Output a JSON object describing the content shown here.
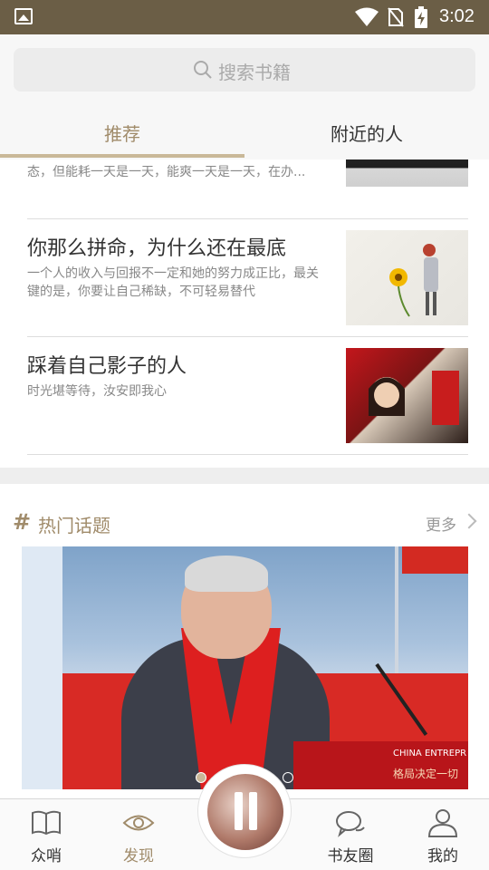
{
  "status_bar": {
    "time": "3:02"
  },
  "header": {
    "search_placeholder": "搜索书籍",
    "tabs": [
      {
        "label": "推荐",
        "active": true
      },
      {
        "label": "附近的人",
        "active": false
      }
    ]
  },
  "articles": [
    {
      "title": "",
      "summary": "态，但能耗一天是一天，能爽一天是一天，在办..."
    },
    {
      "title": "你那么拼命，为什么还在最底",
      "summary": "一个人的收入与回报不一定和她的努力成正比，最关键的是，你要让自己稀缺，不可轻易替代"
    },
    {
      "title": "踩着自己影子的人",
      "summary": "时光堪等待，汝安即我心"
    }
  ],
  "topics": {
    "title": "热门话题",
    "more_label": "更多",
    "banner": {
      "podium_text_en": "CHINA ENTREPR",
      "podium_text_cn": "格局决定一切",
      "current_slide": 1,
      "slide_count": 2
    }
  },
  "bottom_nav": {
    "items": [
      {
        "label": "众哨",
        "icon": "book-icon",
        "active": false
      },
      {
        "label": "发现",
        "icon": "eye-icon",
        "active": true
      },
      {
        "label": "书友圈",
        "icon": "chat-bubbles-icon",
        "active": false
      },
      {
        "label": "我的",
        "icon": "user-icon",
        "active": false
      }
    ],
    "center_button_icon": "pause-icon"
  },
  "colors": {
    "status_bar": "#6b5e46",
    "accent": "#a08b6a",
    "tab_underline": "#c9b898"
  }
}
